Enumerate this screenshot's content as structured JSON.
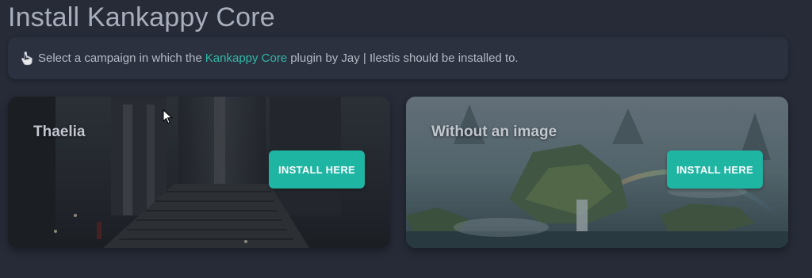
{
  "page": {
    "title": "Install Kankappy Core"
  },
  "notice": {
    "icon": "pointing-hand-icon",
    "text_before": "Select a campaign in which the",
    "plugin_name": "Kankappy Core",
    "text_after": "plugin by Jay | Ilestis should be installed to."
  },
  "campaigns": [
    {
      "name": "Thaelia",
      "button_label": "INSTALL HERE"
    },
    {
      "name": "Without an image",
      "button_label": "INSTALL HERE"
    }
  ],
  "colors": {
    "background": "#262b37",
    "accent": "#1fb5a3",
    "link": "#2fb8a6"
  }
}
